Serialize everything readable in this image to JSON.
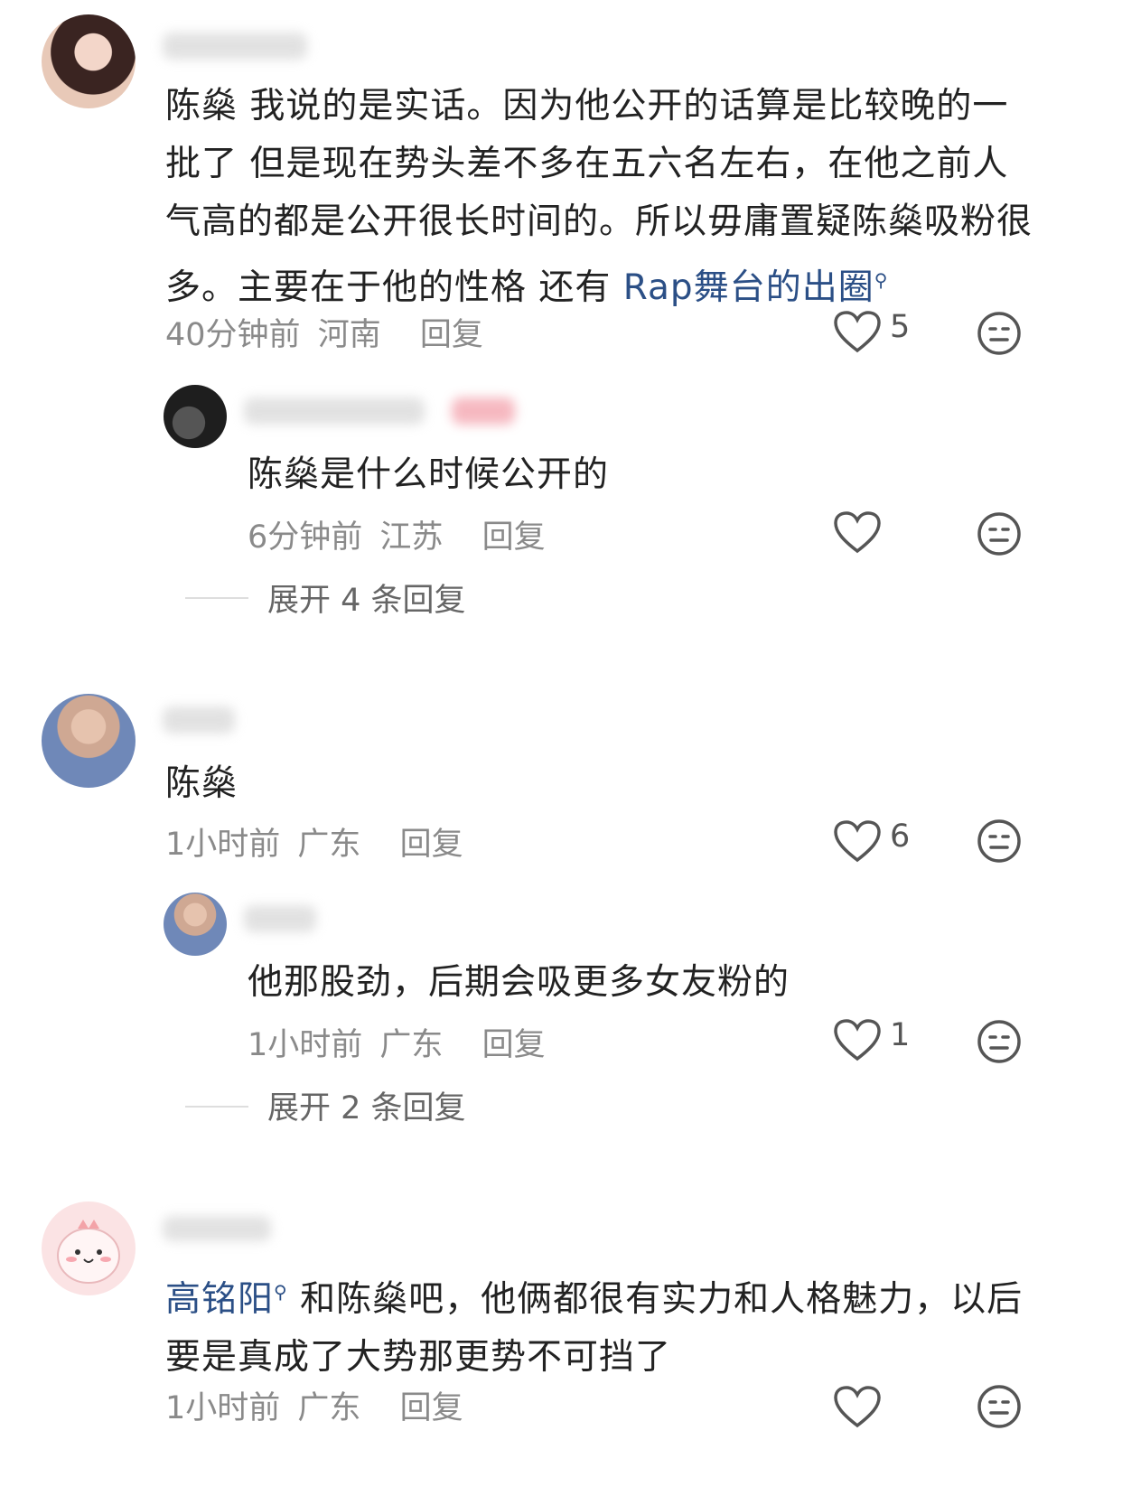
{
  "comments": [
    {
      "text_parts": [
        {
          "text": "陈燊 我说的是实话。因为他公开的话算是比较晚的一批了 但是现在势头差不多在五六名左右，在他之前人气高的都是公开很长时间的。所以毋庸置疑陈燊吸粉很多。主要在于他的性格 还有 ",
          "link": false
        },
        {
          "text": "Rap舞台的出圈",
          "link": true
        }
      ],
      "time": "40分钟前",
      "location": "河南",
      "reply_label": "回复",
      "likes": "5",
      "replies": [
        {
          "text": "陈燊是什么时候公开的",
          "time": "6分钟前",
          "location": "江苏",
          "reply_label": "回复",
          "likes": ""
        }
      ],
      "expand_label": "展开 4 条回复"
    },
    {
      "text_parts": [
        {
          "text": "陈燊",
          "link": false
        }
      ],
      "time": "1小时前",
      "location": "广东",
      "reply_label": "回复",
      "likes": "6",
      "replies": [
        {
          "text": "他那股劲，后期会吸更多女友粉的",
          "time": "1小时前",
          "location": "广东",
          "reply_label": "回复",
          "likes": "1"
        }
      ],
      "expand_label": "展开 2 条回复"
    },
    {
      "text_parts": [
        {
          "text": "高铭阳",
          "link": true
        },
        {
          "text": " 和陈燊吧，他俩都很有实力和人格魅力，以后要是真成了大势那更势不可挡了",
          "link": false
        }
      ],
      "time": "1小时前",
      "location": "广东",
      "reply_label": "回复",
      "likes": ""
    }
  ],
  "colors": {
    "link": "#2b4f86",
    "meta_text": "#8a8a8a",
    "body_text": "#222222"
  },
  "icons": {
    "like": "heart-outline-icon",
    "dislike": "meh-face-icon",
    "search": "search-icon"
  }
}
